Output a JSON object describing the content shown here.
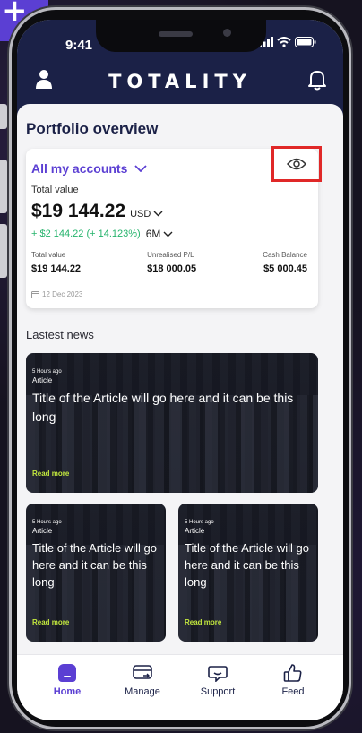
{
  "status": {
    "time": "9:41"
  },
  "header": {
    "brand": "TOTALITY"
  },
  "portfolio": {
    "title": "Portfolio overview",
    "account_selector": "All my accounts",
    "total_value_label": "Total value",
    "total_value": "$19 144.22",
    "currency": "USD",
    "change": "+ $2 144.22 (+ 14.123%)",
    "period": "6M",
    "metrics": [
      {
        "label": "Total value",
        "value": "$19 144.22"
      },
      {
        "label": "Unrealised P/L",
        "value": "$18 000.05"
      },
      {
        "label": "Cash Balance",
        "value": "$5 000.45"
      }
    ],
    "date": "12 Dec 2023"
  },
  "news": {
    "title": "Lastest news",
    "articles": [
      {
        "ago": "5 Hours ago",
        "category": "Article",
        "title": "Title of the Article will go here and it can be this long",
        "cta": "Read more"
      },
      {
        "ago": "5 Hours ago",
        "category": "Article",
        "title": "Title of the Article will go here and it can be this long",
        "cta": "Read more"
      },
      {
        "ago": "5 Hours ago",
        "category": "Article",
        "title": "Title of the Article will go here and it can be this long",
        "cta": "Read more"
      }
    ]
  },
  "nav": {
    "items": [
      {
        "label": "Home",
        "icon": "home-icon",
        "active": true
      },
      {
        "label": "Manage",
        "icon": "manage-icon"
      },
      {
        "label": "Support",
        "icon": "support-icon"
      },
      {
        "label": "Feed",
        "icon": "thumbs-up-icon"
      }
    ]
  },
  "colors": {
    "navy": "#1b2147",
    "accent": "#5b3fd3",
    "gain": "#24b36b",
    "highlight": "#e02828",
    "read_more": "#c3e83e"
  }
}
